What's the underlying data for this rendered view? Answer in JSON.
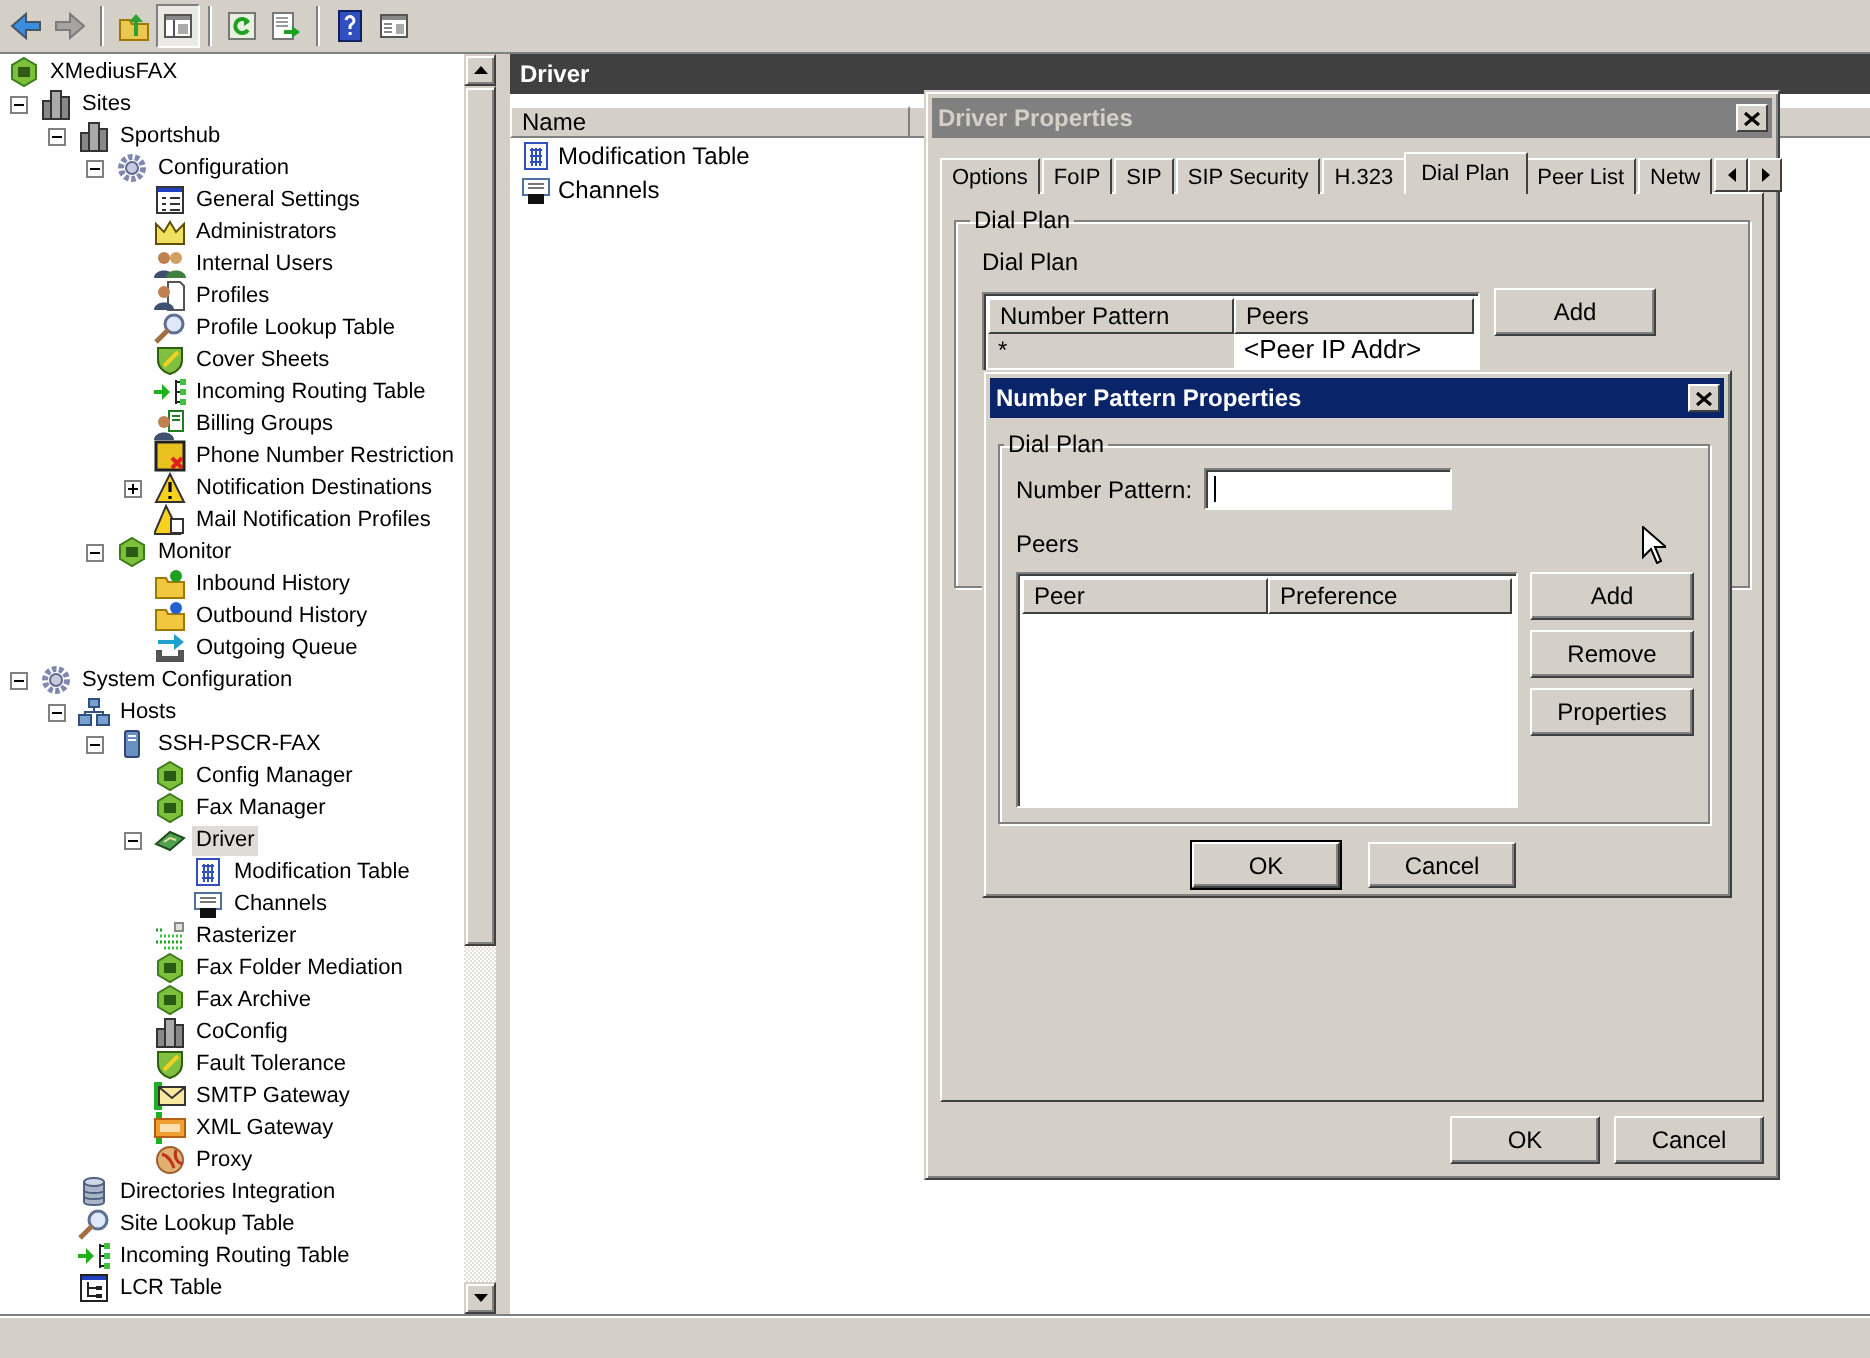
{
  "toolbar": [
    {
      "kind": "back",
      "disabled": false,
      "pressed": false
    },
    {
      "kind": "forward",
      "disabled": true,
      "pressed": false
    },
    {
      "kind": "separator"
    },
    {
      "kind": "up",
      "disabled": false,
      "pressed": false
    },
    {
      "kind": "panes",
      "disabled": false,
      "pressed": true
    },
    {
      "kind": "separator"
    },
    {
      "kind": "refresh",
      "disabled": false,
      "pressed": false
    },
    {
      "kind": "export",
      "disabled": false,
      "pressed": false
    },
    {
      "kind": "separator"
    },
    {
      "kind": "help",
      "disabled": false,
      "pressed": false
    },
    {
      "kind": "window",
      "disabled": false,
      "pressed": false
    }
  ],
  "tree": [
    {
      "label": "XMediusFAX",
      "kind": "hexagon",
      "selected": false,
      "children": [
        {
          "label": "Sites",
          "kind": "building",
          "selected": false,
          "expanded": true,
          "children": [
            {
              "label": "Sportshub",
              "kind": "building",
              "selected": false,
              "expanded": true,
              "children": [
                {
                  "label": "Configuration",
                  "kind": "gear",
                  "selected": false,
                  "expanded": true,
                  "children": [
                    {
                      "label": "General Settings",
                      "kind": "form",
                      "selected": false
                    },
                    {
                      "label": "Administrators",
                      "kind": "crown",
                      "selected": false
                    },
                    {
                      "label": "Internal Users",
                      "kind": "users",
                      "selected": false
                    },
                    {
                      "label": "Profiles",
                      "kind": "profile",
                      "selected": false
                    },
                    {
                      "label": "Profile Lookup Table",
                      "kind": "magnifier",
                      "selected": false
                    },
                    {
                      "label": "Cover Sheets",
                      "kind": "shield",
                      "selected": false
                    },
                    {
                      "label": "Incoming Routing Table",
                      "kind": "routing",
                      "selected": false
                    },
                    {
                      "label": "Billing Groups",
                      "kind": "billing",
                      "selected": false
                    },
                    {
                      "label": "Phone Number Restriction",
                      "kind": "restriction",
                      "selected": false
                    },
                    {
                      "label": "Notification Destinations",
                      "kind": "warning",
                      "selected": false,
                      "expanded": false
                    },
                    {
                      "label": "Mail Notification Profiles",
                      "kind": "mailwarn",
                      "selected": false
                    }
                  ]
                },
                {
                  "label": "Monitor",
                  "kind": "hexagon",
                  "selected": false,
                  "expanded": true,
                  "children": [
                    {
                      "label": "Inbound History",
                      "kind": "folder_in",
                      "selected": false
                    },
                    {
                      "label": "Outbound History",
                      "kind": "folder_out",
                      "selected": false
                    },
                    {
                      "label": "Outgoing Queue",
                      "kind": "queue",
                      "selected": false
                    }
                  ]
                }
              ]
            }
          ]
        },
        {
          "label": "System Configuration",
          "kind": "gear",
          "selected": false,
          "expanded": true,
          "children": [
            {
              "label": "Hosts",
              "kind": "network",
              "selected": false,
              "expanded": true,
              "children": [
                {
                  "label": "SSH-PSCR-FAX",
                  "kind": "server",
                  "selected": false,
                  "expanded": true,
                  "children": [
                    {
                      "label": "Config Manager",
                      "kind": "hexagon",
                      "selected": false
                    },
                    {
                      "label": "Fax Manager",
                      "kind": "hexagon",
                      "selected": false
                    },
                    {
                      "label": "Driver",
                      "kind": "card",
                      "selected": true,
                      "expanded": true,
                      "children": [
                        {
                          "label": "Modification Table",
                          "kind": "grid",
                          "selected": false
                        },
                        {
                          "label": "Channels",
                          "kind": "printer",
                          "selected": false
                        }
                      ]
                    },
                    {
                      "label": "Rasterizer",
                      "kind": "raster",
                      "selected": false
                    },
                    {
                      "label": "Fax Folder Mediation",
                      "kind": "hexagon",
                      "selected": false
                    },
                    {
                      "label": "Fax Archive",
                      "kind": "hexagon",
                      "selected": false
                    },
                    {
                      "label": "CoConfig",
                      "kind": "building",
                      "selected": false
                    },
                    {
                      "label": "Fault Tolerance",
                      "kind": "shield",
                      "selected": false
                    },
                    {
                      "label": "SMTP Gateway",
                      "kind": "mail",
                      "selected": false
                    },
                    {
                      "label": "XML Gateway",
                      "kind": "xml",
                      "selected": false
                    },
                    {
                      "label": "Proxy",
                      "kind": "proxy",
                      "selected": false
                    }
                  ]
                }
              ]
            },
            {
              "label": "Directories Integration",
              "kind": "database",
              "selected": false
            },
            {
              "label": "Site Lookup Table",
              "kind": "magnifier",
              "selected": false
            },
            {
              "label": "Incoming Routing Table",
              "kind": "routing",
              "selected": false
            },
            {
              "label": "LCR Table",
              "kind": "lcr",
              "selected": false
            }
          ]
        }
      ]
    }
  ],
  "details_pane": {
    "title": "Driver",
    "columns": [
      "Name"
    ],
    "items": [
      {
        "label": "Modification Table",
        "kind": "grid"
      },
      {
        "label": "Channels",
        "kind": "printer"
      }
    ]
  },
  "driver_properties": {
    "title": "Driver Properties",
    "active": false,
    "tabs": [
      {
        "label": "Options",
        "selected": false
      },
      {
        "label": "FoIP",
        "selected": false
      },
      {
        "label": "SIP",
        "selected": false
      },
      {
        "label": "SIP Security",
        "selected": false
      },
      {
        "label": "H.323",
        "selected": false
      },
      {
        "label": "Dial Plan",
        "selected": true
      },
      {
        "label": "Peer List",
        "selected": false
      },
      {
        "label": "Netw",
        "selected": false
      }
    ],
    "group": "Dial Plan",
    "label": "Dial Plan",
    "table": {
      "columns": [
        "Number Pattern",
        "Peers"
      ],
      "rows": [
        {
          "cells": [
            "*",
            "<Peer IP Addr>"
          ],
          "selected": true
        }
      ]
    },
    "side_buttons": [
      "Add"
    ],
    "buttons": [
      {
        "label": "OK",
        "default": false
      },
      {
        "label": "Cancel",
        "default": false
      }
    ]
  },
  "number_pattern_properties": {
    "title": "Number Pattern Properties",
    "active": true,
    "group": "Dial Plan",
    "field_label": "Number Pattern:",
    "field_focused": true,
    "peers_label": "Peers",
    "table": {
      "columns": [
        "Peer",
        "Preference"
      ]
    },
    "side_buttons": [
      "Add",
      "Remove",
      "Properties"
    ],
    "buttons": [
      {
        "label": "OK",
        "default": true
      },
      {
        "label": "Cancel",
        "default": false
      }
    ]
  }
}
